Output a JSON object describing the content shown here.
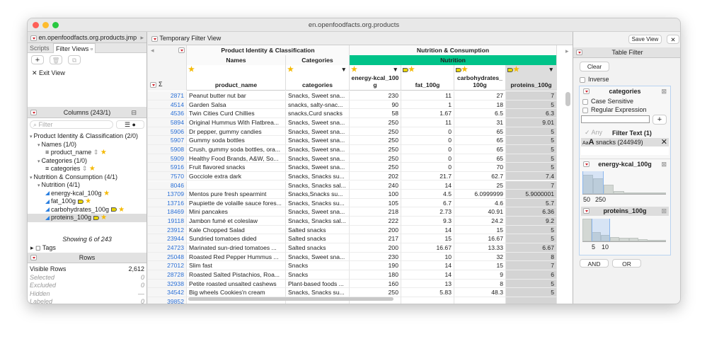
{
  "window": {
    "title": "en.openfoodfacts.org.products"
  },
  "left": {
    "file_label": "en.openfoodfacts.org.products.jmp",
    "tabs": [
      "Scripts",
      "Filter Views"
    ],
    "exit_view": "Exit View",
    "columns_title": "Columns (243/1)",
    "filter_placeholder": "Filter",
    "tree": [
      {
        "label": "Product Identity & Classification (2/0)",
        "level": 0,
        "type": "group"
      },
      {
        "label": "Names (1/0)",
        "level": 1,
        "type": "group"
      },
      {
        "label": "product_name",
        "level": 2,
        "type": "char"
      },
      {
        "label": "Categories (1/0)",
        "level": 1,
        "type": "group"
      },
      {
        "label": "categories",
        "level": 2,
        "type": "char"
      },
      {
        "label": "Nutrition & Consumption (4/1)",
        "level": 0,
        "type": "group"
      },
      {
        "label": "Nutrition (4/1)",
        "level": 1,
        "type": "group"
      },
      {
        "label": "energy-kcal_100g",
        "level": 2,
        "type": "num"
      },
      {
        "label": "fat_100g",
        "level": 2,
        "type": "num",
        "tag": true
      },
      {
        "label": "carbohydrates_100g",
        "level": 2,
        "type": "num",
        "tag": true
      },
      {
        "label": "proteins_100g",
        "level": 2,
        "type": "num",
        "tag": true,
        "selected": true
      }
    ],
    "showing": "Showing 6 of 243",
    "tags": "Tags",
    "rows_title": "Rows",
    "rows_stats": [
      {
        "label": "Visible Rows",
        "value": "2,612"
      },
      {
        "label": "Selected",
        "value": "0"
      },
      {
        "label": "Excluded",
        "value": "0"
      },
      {
        "label": "Hidden",
        "value": "—"
      },
      {
        "label": "Labeled",
        "value": "0"
      }
    ]
  },
  "table": {
    "view_title": "Temporary Filter View",
    "save_view": "Save View",
    "groups": [
      "Product Identity & Classification",
      "Nutrition & Consumption"
    ],
    "subgroups": [
      "Names",
      "Categories",
      "Nutrition"
    ],
    "nutrition_color": "#00c389",
    "columns": [
      "product_name",
      "categories",
      "energy-kcal_100g",
      "fat_100g",
      "carbohydrates_100g",
      "proteins_100g"
    ],
    "rows": [
      [
        "2871",
        "Peanut butter nut bar",
        "Snacks, Sweet sna...",
        "230",
        "11",
        "27",
        "7"
      ],
      [
        "4514",
        "Garden Salsa",
        "snacks, salty-snac...",
        "90",
        "1",
        "18",
        "5"
      ],
      [
        "4536",
        "Twin Cities Curd Chillies",
        "snacks,Curd snacks",
        "58",
        "1.67",
        "6.5",
        "6.3"
      ],
      [
        "5894",
        "Original Hummus With Flatbrea...",
        "Snacks, Sweet sna...",
        "250",
        "11",
        "31",
        "9.01"
      ],
      [
        "5906",
        "Dr pepper, gummy candies",
        "Snacks, Sweet sna...",
        "250",
        "0",
        "65",
        "5"
      ],
      [
        "5907",
        "Gummy soda bottles",
        "Snacks, Sweet sna...",
        "250",
        "0",
        "65",
        "5"
      ],
      [
        "5908",
        "Crush, gummy soda bottles, ora...",
        "Snacks, Sweet sna...",
        "250",
        "0",
        "65",
        "5"
      ],
      [
        "5909",
        "Healthy Food Brands, A&W, So...",
        "Snacks, Sweet sna...",
        "250",
        "0",
        "65",
        "5"
      ],
      [
        "5916",
        "Fruit flavored snacks",
        "Snacks, Sweet sna...",
        "250",
        "0",
        "70",
        "5"
      ],
      [
        "7570",
        "Gocciole extra dark",
        "Snacks, Snacks su...",
        "202",
        "21.7",
        "62.7",
        "7.4"
      ],
      [
        "8046",
        "",
        "Snacks, Snacks sal...",
        "240",
        "14",
        "25",
        "7"
      ],
      [
        "13709",
        "Mentos pure fresh spearmint",
        "Snacks,Snacks su...",
        "100",
        "4.5",
        "6.0999999",
        "5.9000001"
      ],
      [
        "13716",
        "Paupiette de volaille sauce fores...",
        "Snacks, Snacks su...",
        "105",
        "6.7",
        "4.6",
        "5.7"
      ],
      [
        "18469",
        "Mini pancakes",
        "Snacks, Sweet sna...",
        "218",
        "2.73",
        "40.91",
        "6.36"
      ],
      [
        "19118",
        "Jambon fumé et coleslaw",
        "Snacks, Snacks sal...",
        "222",
        "9.3",
        "24.2",
        "9.2"
      ],
      [
        "23912",
        "Kale Chopped Salad",
        "Salted snacks",
        "200",
        "14",
        "15",
        "5"
      ],
      [
        "23944",
        "Sundried tomatoes dided",
        "Salted snacks",
        "217",
        "15",
        "16.67",
        "5"
      ],
      [
        "24723",
        "Marinated sun-dried tomatoes ...",
        "Salted snacks",
        "200",
        "16.67",
        "13.33",
        "6.67"
      ],
      [
        "25048",
        "Roasted Red Pepper Hummus ...",
        "Snacks, Sweet sna...",
        "230",
        "10",
        "32",
        "8"
      ],
      [
        "27012",
        "Slim fast",
        "Snacks",
        "190",
        "14",
        "15",
        "7"
      ],
      [
        "28728",
        "Roasted Salted Pistachios, Roa...",
        "Snacks",
        "180",
        "14",
        "9",
        "6"
      ],
      [
        "32938",
        "Petite roasted unsalted cashews",
        "Plant-based foods ...",
        "160",
        "13",
        "8",
        "5"
      ],
      [
        "34542",
        "Big wheels Cookies'n cream",
        "Snacks, Snacks su...",
        "250",
        "5.83",
        "48.3",
        "5"
      ],
      [
        "39852",
        "",
        "",
        "",
        "",
        "",
        ""
      ]
    ]
  },
  "filter": {
    "title": "Table Filter",
    "clear": "Clear",
    "inverse": "Inverse",
    "categories": {
      "title": "categories",
      "case_sensitive": "Case Sensitive",
      "regex": "Regular Expression",
      "any": "Any",
      "filter_text": "Filter Text (1)",
      "item": "snacks (244949)",
      "aa": "Aa",
      "a": "A"
    },
    "energy": {
      "title": "energy-kcal_100g",
      "ticks": [
        "50",
        "250"
      ],
      "hist": [
        0.85,
        0.7,
        0.42,
        0.12,
        0.06,
        0.02,
        0.01,
        0.01
      ],
      "selection": [
        0,
        1
      ]
    },
    "proteins": {
      "title": "proteins_100g",
      "ticks": [
        "5",
        "10"
      ],
      "hist": [
        1.0,
        0.42,
        0.28,
        0.2,
        0.16,
        0.16,
        0.1,
        0.06,
        0.04
      ],
      "selection": [
        1,
        2
      ]
    },
    "and": "AND",
    "or": "OR"
  }
}
